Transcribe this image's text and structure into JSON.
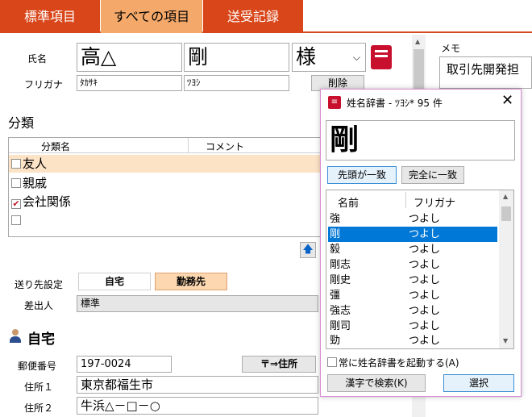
{
  "tabs": [
    "標準項目",
    "すべての項目",
    "送受記録"
  ],
  "name": {
    "label": "氏名",
    "last": "高△",
    "first": "剛",
    "honorific": "様",
    "furigana_label": "フリガナ",
    "last_kana": "ﾀｶｻｷ",
    "first_kana": "ﾂﾖｼ",
    "delete_button": "削除"
  },
  "memo": {
    "label": "メモ",
    "value": "取引先開発担"
  },
  "category": {
    "heading": "分類",
    "col_name": "分類名",
    "col_comment": "コメント",
    "rows": [
      {
        "label": "友人",
        "checked": false,
        "mark": ""
      },
      {
        "label": "親戚",
        "checked": false,
        "mark": ""
      },
      {
        "label": "会社関係",
        "checked": true,
        "mark": "✔"
      },
      {
        "label": "",
        "checked": false,
        "mark": ""
      }
    ]
  },
  "send": {
    "label": "送り先設定",
    "home": "自宅",
    "work": "勤務先",
    "sender_label": "差出人",
    "sender_value": "標準"
  },
  "home": {
    "heading": "自宅",
    "postal_label": "郵便番号",
    "postal_value": "197-0024",
    "to_address_button": "〒⇒住所",
    "addr1_label": "住所１",
    "addr1_value": "東京都福生市",
    "addr2_label": "住所２",
    "addr2_value": "牛浜△－□－○"
  },
  "dialog": {
    "title": "姓名辞書 - ﾂﾖｼ* 95 件",
    "query": "剛",
    "prefix_button": "先頭が一致",
    "exact_button": "完全に一致",
    "col_name": "名前",
    "col_kana": "フリガナ",
    "rows": [
      {
        "name": "強",
        "kana": "つよし"
      },
      {
        "name": "剛",
        "kana": "つよし"
      },
      {
        "name": "毅",
        "kana": "つよし"
      },
      {
        "name": "剛志",
        "kana": "つよし"
      },
      {
        "name": "剛史",
        "kana": "つよし"
      },
      {
        "name": "彊",
        "kana": "つよし"
      },
      {
        "name": "強志",
        "kana": "つよし"
      },
      {
        "name": "剛司",
        "kana": "つよし"
      },
      {
        "name": "勁",
        "kana": "つよし"
      }
    ],
    "always_launch": "常に姓名辞書を起動する(A)",
    "search_kanji_button": "漢字で検索(K)",
    "select_button": "選択"
  },
  "colors": {
    "tab": "#d8461a",
    "tab_active": "#f4a96a",
    "selection": "#0078d7",
    "category_highlight": "#fde3c6"
  }
}
